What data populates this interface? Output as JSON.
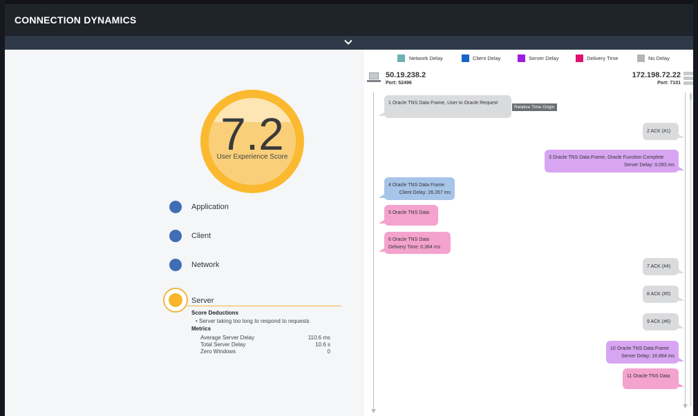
{
  "header": {
    "title": "CONNECTION DYNAMICS"
  },
  "collapse": {
    "icon": "chevron-down-icon"
  },
  "score": {
    "value": "7.2",
    "label": "User Experience Score",
    "fill_level": 0.72,
    "ring_color": "#fbb92f"
  },
  "categories": [
    {
      "label": "Application",
      "color": "#3f6db6"
    },
    {
      "label": "Client",
      "color": "#3f6db6"
    },
    {
      "label": "Network",
      "color": "#3f6db6"
    }
  ],
  "server": {
    "label": "Server",
    "color": "#f9b52c",
    "deductions_title": "Score Deductions",
    "deductions": [
      "• Server taking too long to respond to requests"
    ],
    "metrics_title": "Metrics",
    "metrics": [
      {
        "name": "Average Server Delay",
        "value": "110.6 ms"
      },
      {
        "name": "Total Server Delay",
        "value": "10.6 s"
      },
      {
        "name": "Zero Windows",
        "value": "0"
      }
    ]
  },
  "legend": [
    {
      "label": "Network Delay",
      "color": "#6fb0b4"
    },
    {
      "label": "Client Delay",
      "color": "#1565c9"
    },
    {
      "label": "Server Delay",
      "color": "#a01ce0"
    },
    {
      "label": "Delivery Time",
      "color": "#e0116f"
    },
    {
      "label": "No Delay",
      "color": "#b4b4b4"
    }
  ],
  "client_host": {
    "ip": "50.19.238.2",
    "port": "Port: 52496",
    "icon": "laptop-icon"
  },
  "server_host": {
    "ip": "172.198.72.22",
    "port": "Port: 7101",
    "icon": "server-rack-icon"
  },
  "origin_tag": "Relative Time Origin",
  "messages": [
    {
      "label": "1  Oracle TNS Data Frame, User to Oracle Request",
      "sub": "",
      "kind": "none",
      "side": "left"
    },
    {
      "label": "2  ACK (#1)",
      "sub": "",
      "kind": "none",
      "side": "right"
    },
    {
      "label": "3  Oracle TNS Data Frame, Oracle Function Complete",
      "sub": "Server Delay:  0.093 ms",
      "kind": "server",
      "side": "right"
    },
    {
      "label": "4  Oracle TNS Data Frame",
      "sub": "Client Delay:  26.267 ms",
      "kind": "client",
      "side": "left"
    },
    {
      "label": "5  Oracle TNS Data",
      "sub": "",
      "kind": "delivery",
      "side": "left"
    },
    {
      "label": "6  Oracle TNS Data",
      "sub": "Delivery Time:  0.364 ms",
      "kind": "delivery",
      "side": "left"
    },
    {
      "label": "7  ACK (#4)",
      "sub": "",
      "kind": "none",
      "side": "right"
    },
    {
      "label": "8  ACK (#5)",
      "sub": "",
      "kind": "none",
      "side": "right"
    },
    {
      "label": "9  ACK (#6)",
      "sub": "",
      "kind": "none",
      "side": "right"
    },
    {
      "label": "10  Oracle TNS Data Frame",
      "sub": "Server Delay:  16.884 ms",
      "kind": "server",
      "side": "right"
    },
    {
      "label": "11  Oracle TNS Data",
      "sub": "",
      "kind": "delivery",
      "side": "right"
    }
  ],
  "bubble_colors": {
    "none": "#dadbdd",
    "client": "#a7c4e9",
    "server": "#d8a5f2",
    "delivery": "#f3a3cd"
  }
}
